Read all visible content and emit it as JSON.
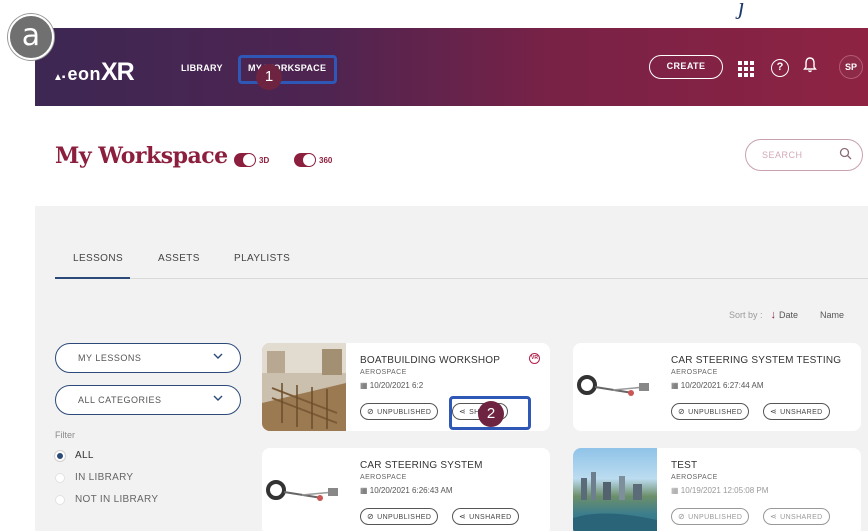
{
  "figure_label": "a",
  "header": {
    "logo_text": "eon",
    "logo_xr": "XR",
    "nav": {
      "library": "LIBRARY",
      "my_workspace": "MY WORKSPACE"
    },
    "create_label": "CREATE",
    "help_glyph": "?",
    "bell_glyph": "🔔",
    "avatar_initials": "SP"
  },
  "title_band": {
    "page_title": "My Workspace",
    "toggle_3d": "3D",
    "toggle_360": "360",
    "search_placeholder": "SEARCH"
  },
  "tabs": [
    "LESSONS",
    "ASSETS",
    "PLAYLISTS"
  ],
  "sort": {
    "label": "Sort by :",
    "active": "Date",
    "other": "Name"
  },
  "filters": {
    "dropdown_lessons": "MY LESSONS",
    "dropdown_categories": "ALL CATEGORIES",
    "filter_label": "Filter",
    "radios": [
      "ALL",
      "IN LIBRARY",
      "NOT IN LIBRARY"
    ],
    "selected_radio": "ALL"
  },
  "cards": [
    {
      "title": "BOATBUILDING WORKSHOP",
      "category": "AEROSPACE",
      "date": "10/20/2021 6:2",
      "status": "UNPUBLISHED",
      "share": "SHARED",
      "badge": "VR"
    },
    {
      "title": "CAR STEERING SYSTEM TESTING",
      "category": "AEROSPACE",
      "date": "10/20/2021 6:27:44 AM",
      "status": "UNPUBLISHED",
      "share": "UNSHARED"
    },
    {
      "title": "CAR STEERING SYSTEM",
      "category": "AEROSPACE",
      "date": "10/20/2021 6:26:43 AM",
      "status": "UNPUBLISHED",
      "share": "UNSHARED"
    },
    {
      "title": "TEST",
      "category": "AEROSPACE",
      "date": "10/19/2021 12:05:08 PM",
      "status": "UNPUBLISHED",
      "share": "UNSHARED"
    }
  ],
  "callouts": {
    "one": "1",
    "two": "2"
  },
  "colors": {
    "brand": "#8b1f3d",
    "highlight": "#2f58b6",
    "navy": "#2b4a7a"
  }
}
